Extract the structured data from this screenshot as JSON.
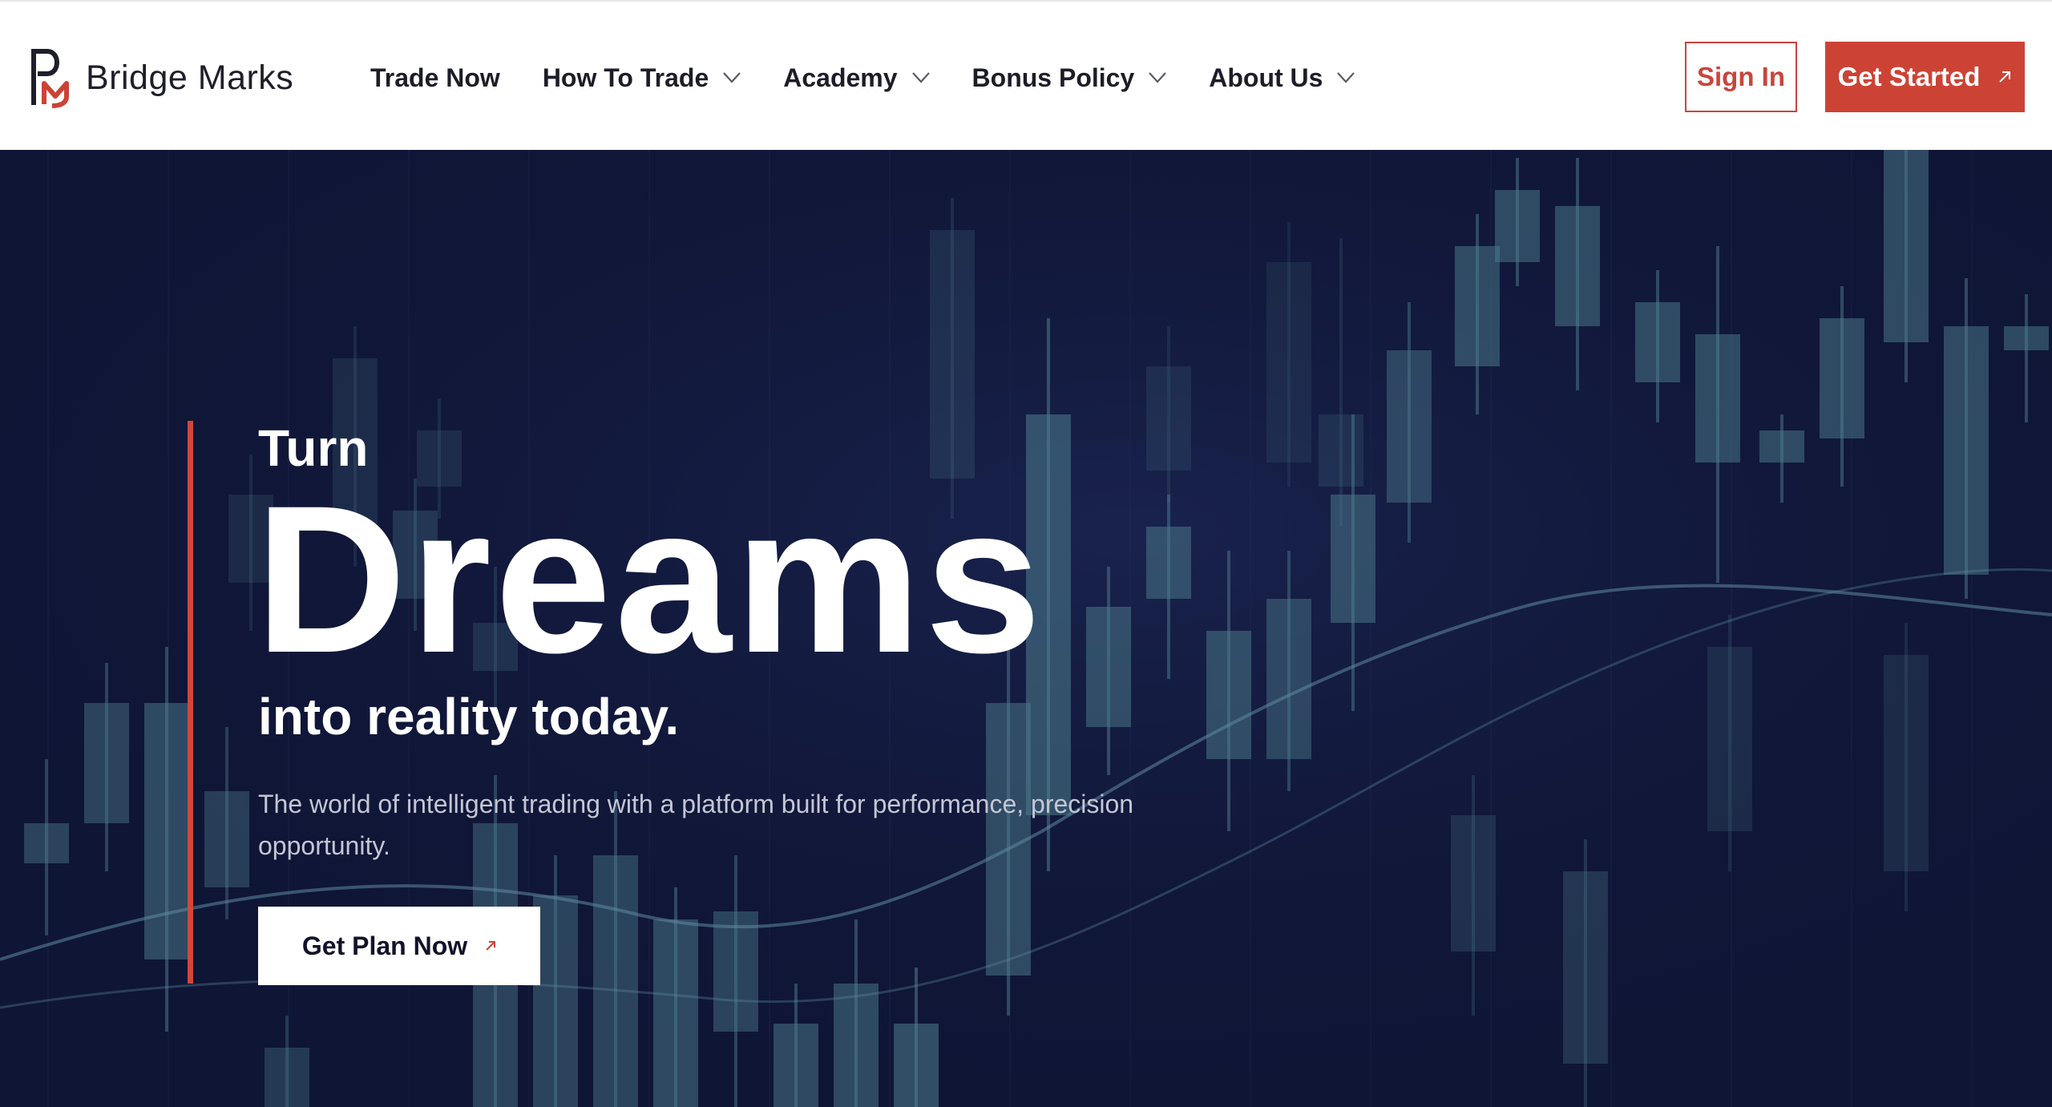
{
  "brand": {
    "name": "Bridge Marks",
    "accent_color": "#cc4335",
    "dark_color": "#1f1f2b"
  },
  "nav": {
    "items": [
      {
        "label": "Trade Now",
        "has_dropdown": false,
        "icon": ""
      },
      {
        "label": "How To Trade",
        "has_dropdown": true,
        "icon": "chevron-down-icon"
      },
      {
        "label": "Academy",
        "has_dropdown": true,
        "icon": "chevron-down-icon"
      },
      {
        "label": "Bonus Policy",
        "has_dropdown": true,
        "icon": "chevron-down-icon"
      },
      {
        "label": "About Us",
        "has_dropdown": true,
        "icon": "chevron-down-icon"
      }
    ],
    "sign_in_label": "Sign In",
    "get_started_label": "Get Started",
    "get_started_icon": "arrow-up-right-icon"
  },
  "hero": {
    "line1": "Turn",
    "headline": "Dreams",
    "line3": "into reality today.",
    "subtitle": "The world of intelligent trading with a platform built for performance, precision opportunity.",
    "cta_label": "Get Plan Now",
    "cta_icon": "arrow-up-right-icon",
    "background_color": "#0f1535",
    "candle_color": "#4e7d8e"
  }
}
